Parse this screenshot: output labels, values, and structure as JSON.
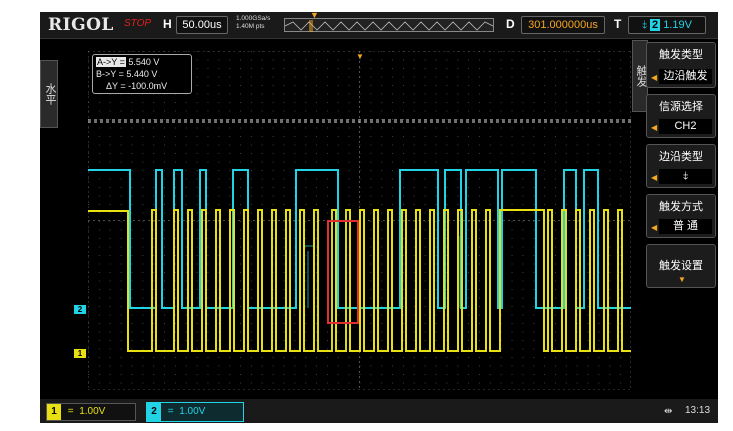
{
  "header": {
    "brand": "RIGOL",
    "run_state": "STOP",
    "h_label": "H",
    "timebase": "50.00us",
    "sample_rate": "1.000GSa/s",
    "memory_depth": "1.40M pts",
    "d_label": "D",
    "delay": "301.000000us",
    "t_label": "T",
    "trigger_channel": "2",
    "trigger_level": "1.19V",
    "trigger_icon": "falling-edge-icon"
  },
  "left_tab": {
    "label": "水平"
  },
  "cursor": {
    "line1_label": "A->Y =",
    "line1_value": "5.540 V",
    "line2": "B->Y = 5.440 V",
    "line3": "ΔY = -100.0mV"
  },
  "menu": {
    "tab_label": "触发",
    "items": [
      {
        "title": "触发类型",
        "value": "边沿触发"
      },
      {
        "title": "信源选择",
        "value": "CH2"
      },
      {
        "title": "边沿类型",
        "value": ""
      },
      {
        "title": "触发方式",
        "value": "普  通"
      },
      {
        "title": "触发设置",
        "value": ""
      }
    ]
  },
  "channels": [
    {
      "num": "1",
      "coupling": "=",
      "scale": "1.00V",
      "color": "#e8e010"
    },
    {
      "num": "2",
      "coupling": "=",
      "scale": "1.00V",
      "color": "#22d3e6"
    }
  ],
  "status": {
    "clock": "13:13",
    "usb_icon": "usb-icon"
  },
  "colors": {
    "ch1": "#e8e010",
    "ch2": "#22d3e6",
    "accent": "#f5a623",
    "highlight": "#e03030"
  }
}
